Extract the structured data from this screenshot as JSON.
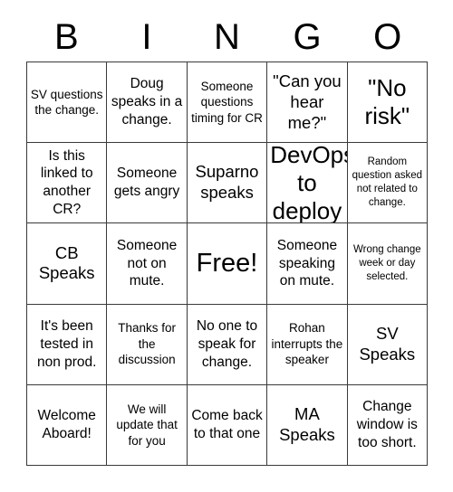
{
  "card": {
    "title_letters": [
      "B",
      "I",
      "N",
      "G",
      "O"
    ],
    "columns": [
      "B",
      "I",
      "N",
      "G",
      "O"
    ],
    "free_space_label": "Free!",
    "rows": [
      [
        {
          "text": "SV questions the change.",
          "size": "s"
        },
        {
          "text": "Doug speaks in a change.",
          "size": "m"
        },
        {
          "text": "Someone questions timing for CR",
          "size": "s"
        },
        {
          "text": "\"Can you hear me?\"",
          "size": "l"
        },
        {
          "text": "\"No risk\"",
          "size": "xl"
        }
      ],
      [
        {
          "text": "Is this linked to another CR?",
          "size": "m"
        },
        {
          "text": "Someone gets angry",
          "size": "m"
        },
        {
          "text": "Suparno speaks",
          "size": "l"
        },
        {
          "text": "DevOps to deploy",
          "size": "xl"
        },
        {
          "text": "Random question asked not related to change.",
          "size": "xs"
        }
      ],
      [
        {
          "text": "CB Speaks",
          "size": "l"
        },
        {
          "text": "Someone not on mute.",
          "size": "m"
        },
        {
          "text": "Free!",
          "size": "xxl"
        },
        {
          "text": "Someone speaking on mute.",
          "size": "m"
        },
        {
          "text": "Wrong change week or day selected.",
          "size": "xs"
        }
      ],
      [
        {
          "text": "It's been tested in non prod.",
          "size": "m"
        },
        {
          "text": "Thanks for the discussion",
          "size": "s"
        },
        {
          "text": "No one to speak for change.",
          "size": "m"
        },
        {
          "text": "Rohan interrupts the speaker",
          "size": "s"
        },
        {
          "text": "SV Speaks",
          "size": "l"
        }
      ],
      [
        {
          "text": "Welcome Aboard!",
          "size": "m"
        },
        {
          "text": "We will update that for you",
          "size": "s"
        },
        {
          "text": "Come back to that one",
          "size": "m"
        },
        {
          "text": "MA Speaks",
          "size": "l"
        },
        {
          "text": "Change window is too short.",
          "size": "m"
        }
      ]
    ]
  },
  "colors": {
    "background": "#ffffff",
    "text": "#000000",
    "grid_line": "#3a3a3a"
  }
}
